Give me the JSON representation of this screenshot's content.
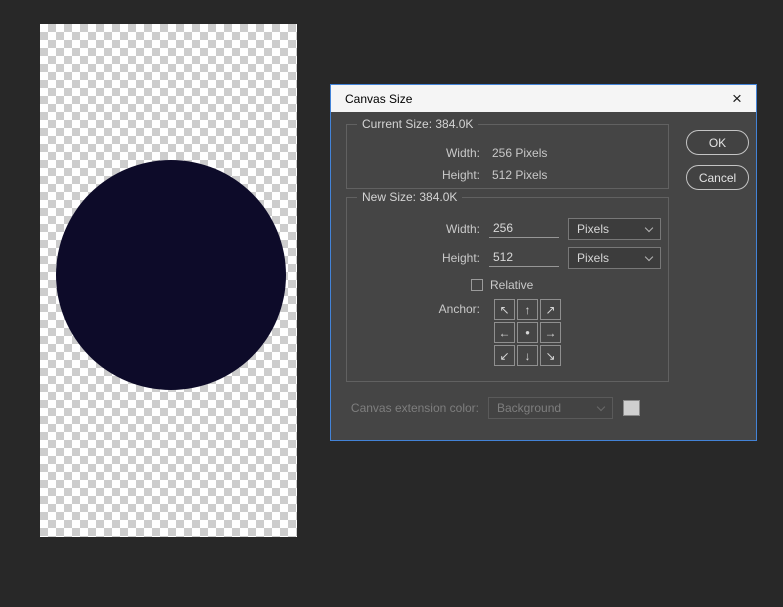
{
  "window": {
    "title": "Canvas Size",
    "close_label": "×"
  },
  "canvas": {
    "shape": "circle"
  },
  "colors": {
    "workspace_bg": "#282828",
    "dialog_bg": "#454545",
    "titlebar_bg": "#f5f5f5",
    "dialog_accent_border": "#4383d7",
    "circle_fill": "#0d0b29",
    "checker_light": "#ffffff",
    "checker_dark": "#cdcdcd"
  },
  "dialog": {
    "buttons": {
      "ok": "OK",
      "cancel": "Cancel"
    },
    "current": {
      "legend": "Current Size: 384.0K",
      "rows": [
        {
          "label": "Width:",
          "value": "256 Pixels"
        },
        {
          "label": "Height:",
          "value": "512 Pixels"
        }
      ]
    },
    "new_size": {
      "legend": "New Size: 384.0K",
      "width_label": "Width:",
      "width_value": "256",
      "width_unit": "Pixels",
      "height_label": "Height:",
      "height_value": "512",
      "height_unit": "Pixels",
      "relative_label": "Relative",
      "anchor_label": "Anchor:",
      "anchor_cells": [
        "↖",
        "↑",
        "↗",
        "←",
        "●",
        "→",
        "↙",
        "↓",
        "↘"
      ]
    },
    "extension": {
      "label": "Canvas extension color:",
      "value": "Background"
    }
  }
}
